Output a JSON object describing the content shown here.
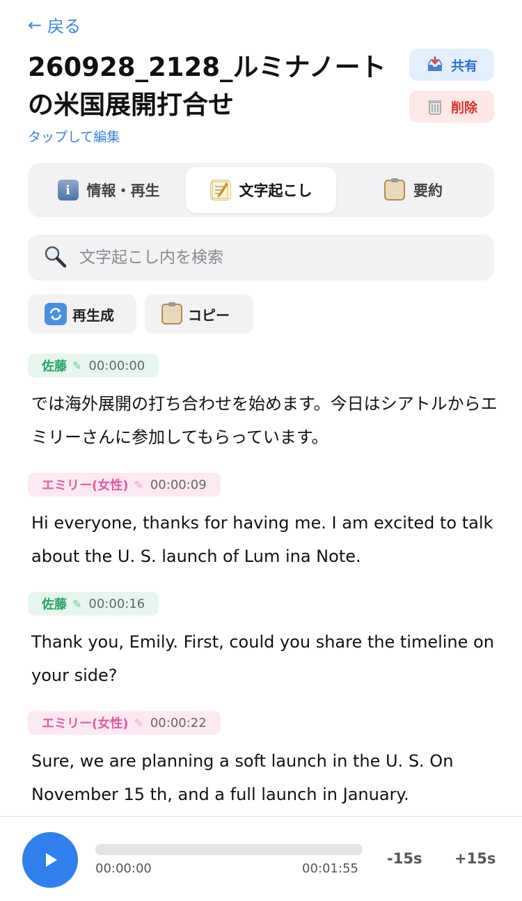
{
  "header": {
    "back_label": "戻る",
    "title": "260928_2128_ルミナノートの米国展開打合せ",
    "edit_hint": "タップして編集",
    "share_label": "共有",
    "delete_label": "削除"
  },
  "tabs": [
    {
      "label": "情報・再生",
      "icon": "info-icon",
      "active": false
    },
    {
      "label": "文字起こし",
      "icon": "memo-icon",
      "active": true
    },
    {
      "label": "要約",
      "icon": "clipboard-icon",
      "active": false
    }
  ],
  "search": {
    "placeholder": "文字起こし内を検索",
    "value": ""
  },
  "tools": {
    "regenerate_label": "再生成",
    "copy_label": "コピー"
  },
  "transcript": [
    {
      "speaker": "佐藤",
      "color": "green",
      "time": "00:00:00",
      "text": "では海外展開の打ち合わせを始めます。今日はシアトルからエミリーさんに参加してもらっています。"
    },
    {
      "speaker": "エミリー(女性)",
      "color": "pink",
      "time": "00:00:09",
      "text": "Hi everyone, thanks for having me. I am excited to talk about the U. S. launch of Lum ina Note."
    },
    {
      "speaker": "佐藤",
      "color": "green",
      "time": "00:00:16",
      "text": "Thank you, Emily. First, could you share the timeline on your side?"
    },
    {
      "speaker": "エミリー(女性)",
      "color": "pink",
      "time": "00:00:22",
      "text": "Sure, we are planning a soft launch in the U. S. On November 15 th, and a full launch in January."
    }
  ],
  "player": {
    "current_time": "00:00:00",
    "total_time": "00:01:55",
    "progress": 0,
    "skip_back_label": "-15s",
    "skip_forward_label": "+15s"
  },
  "colors": {
    "accent": "#2f80ed",
    "speaker_green": "#27a567",
    "speaker_pink": "#e45ca0",
    "delete_red": "#d8322d"
  }
}
